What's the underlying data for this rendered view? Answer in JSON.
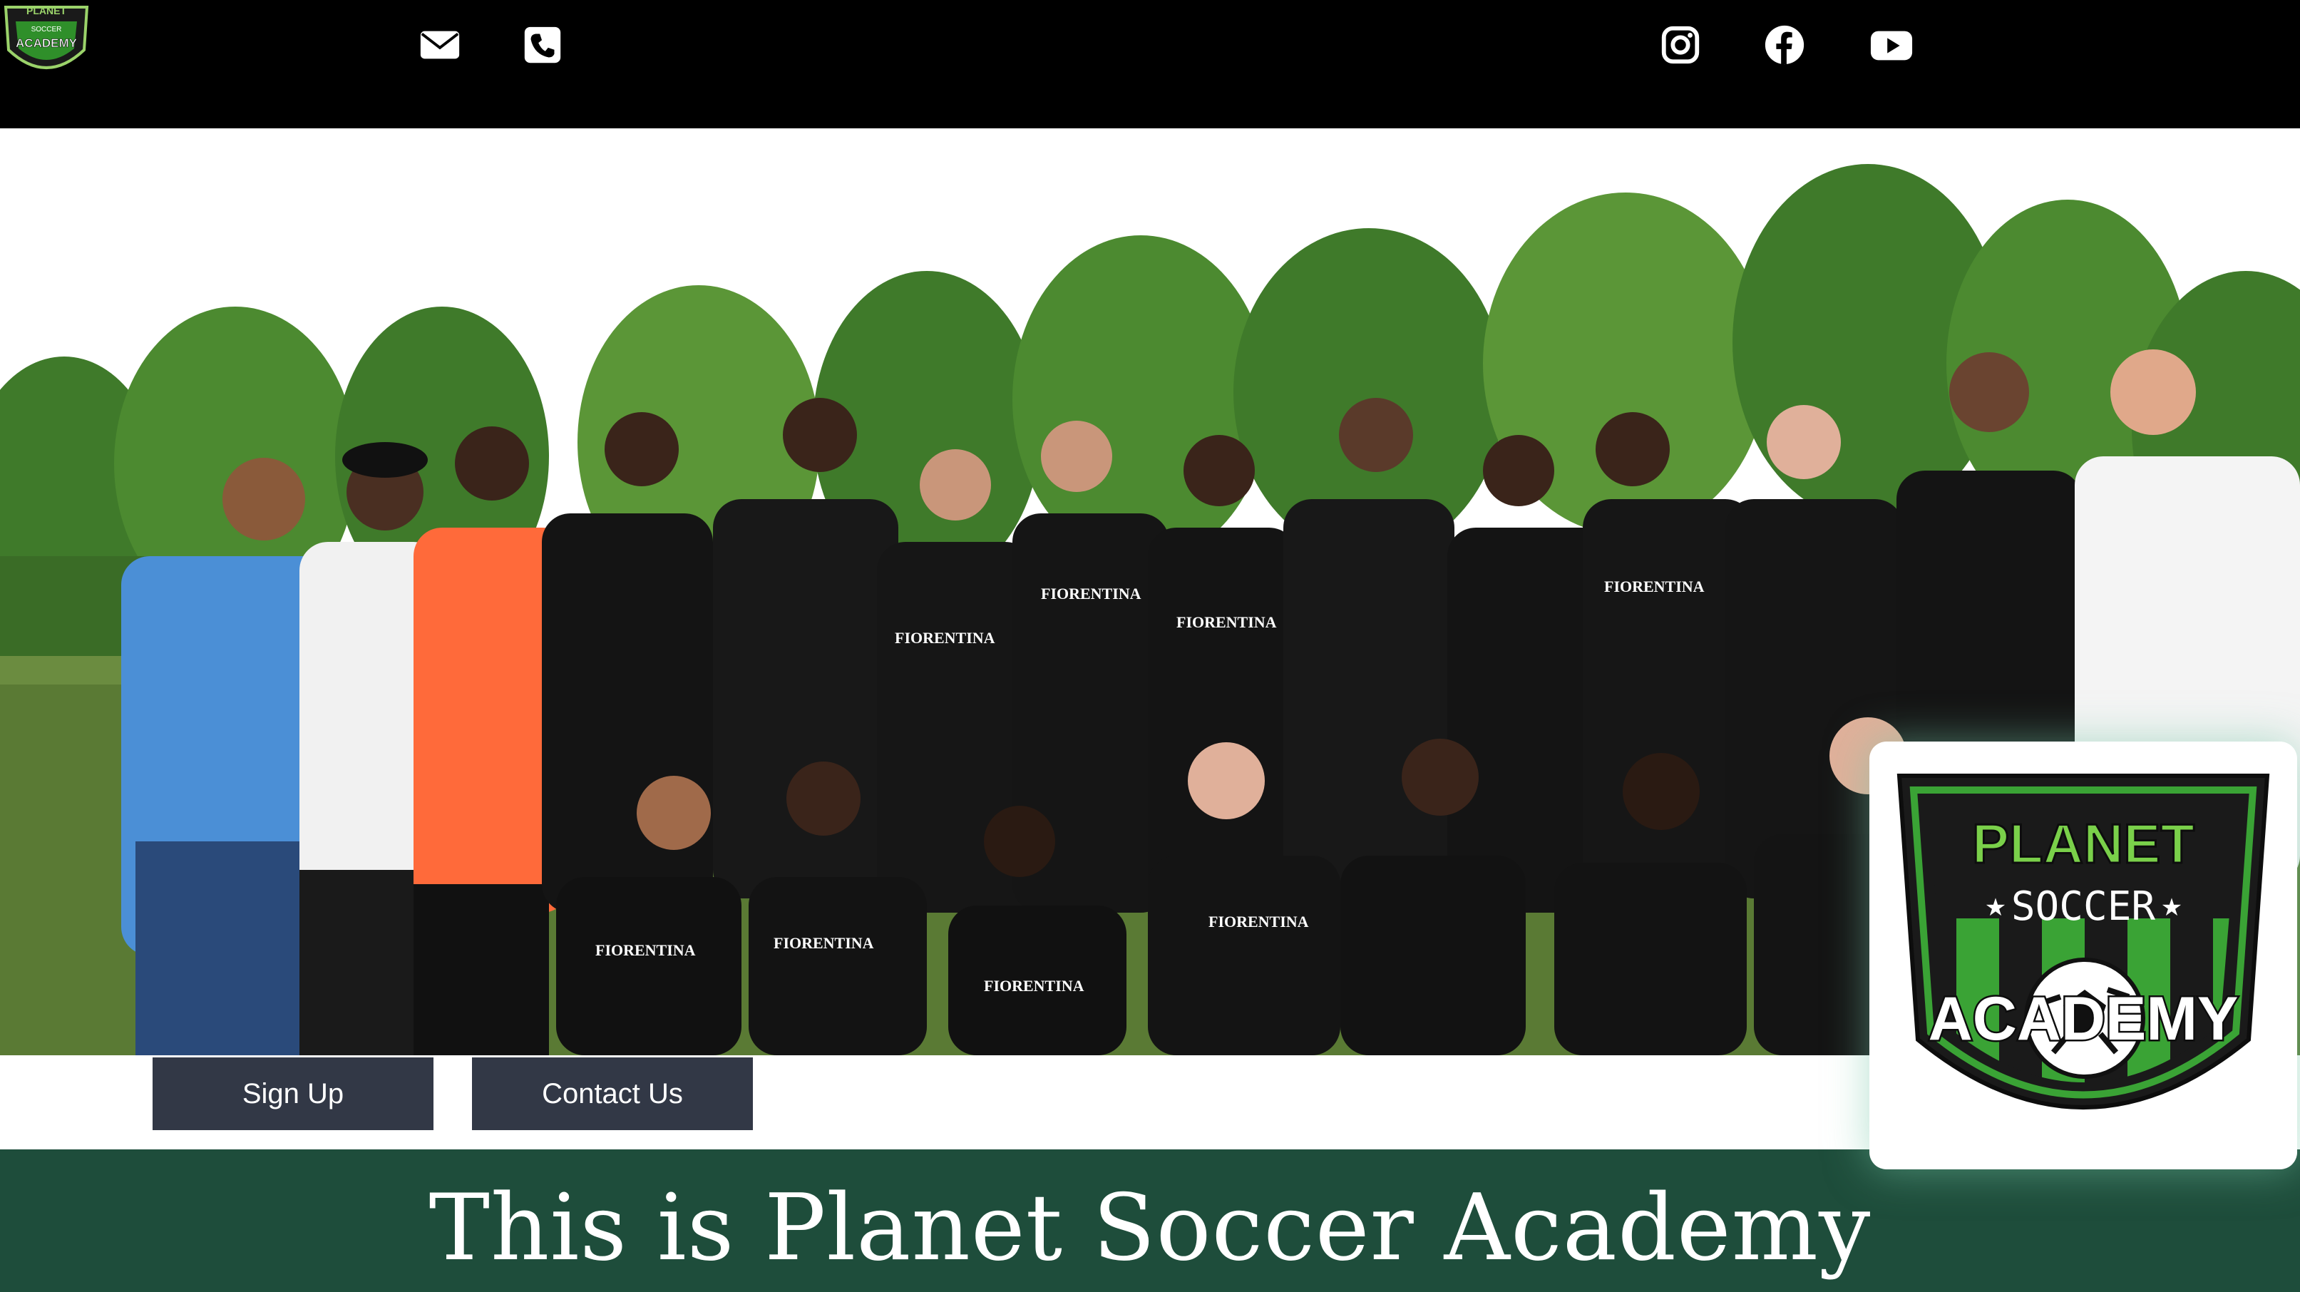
{
  "header": {
    "logo": {
      "line1": "PLANET",
      "line2": "SOCCER",
      "line3": "ACADEMY"
    },
    "contact_icons": [
      "envelope-icon",
      "phone-icon"
    ],
    "social_icons": [
      "instagram-icon",
      "facebook-icon",
      "youtube-icon"
    ]
  },
  "hero": {
    "jersey_text": "FIORENTINA"
  },
  "actions": {
    "signup_label": "Sign Up",
    "contact_label": "Contact Us"
  },
  "badge": {
    "line1": "PLANET",
    "line2": "SOCCER",
    "line3": "ACADEMY"
  },
  "section": {
    "heading": "This is Planet Soccer Academy"
  },
  "colors": {
    "topbar": "#000000",
    "button": "#323846",
    "band": "#1e4d3b",
    "brand_green": "#3aa335"
  }
}
